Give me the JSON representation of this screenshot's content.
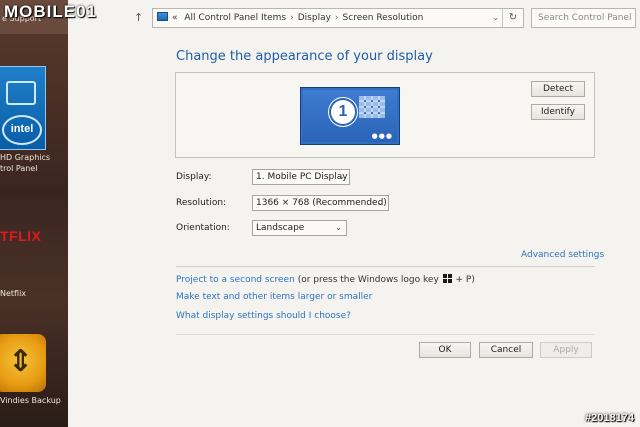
{
  "watermark": {
    "brand": "MOBILE01",
    "photo_id": "#2018174"
  },
  "desktop": {
    "top_text": "e Support",
    "intel_logo": "intel",
    "intel_label_1": "HD Graphics",
    "intel_label_2": "trol Panel",
    "netflix_logo": "TFLIX",
    "netflix_label": "Netflix",
    "backup_label": "Vindies Backup"
  },
  "address_bar": {
    "prefix": "«",
    "crumbs": [
      "All Control Panel Items",
      "Display",
      "Screen Resolution"
    ],
    "search_placeholder": "Search Control Panel"
  },
  "page": {
    "heading": "Change the appearance of your display",
    "monitor_number": "1",
    "detect_label": "Detect",
    "identify_label": "Identify",
    "display_label": "Display:",
    "display_value": "1. Mobile PC Display",
    "resolution_label": "Resolution:",
    "resolution_value": "1366 × 768 (Recommended)",
    "orientation_label": "Orientation:",
    "orientation_value": "Landscape",
    "advanced_link": "Advanced settings",
    "project_link": "Project to a second screen",
    "project_suffix_1": "(or press the Windows logo key",
    "project_suffix_2": "+ P)",
    "larger_link": "Make text and other items larger or smaller",
    "help_link": "What display settings should I choose?",
    "ok_label": "OK",
    "cancel_label": "Cancel",
    "apply_label": "Apply"
  }
}
